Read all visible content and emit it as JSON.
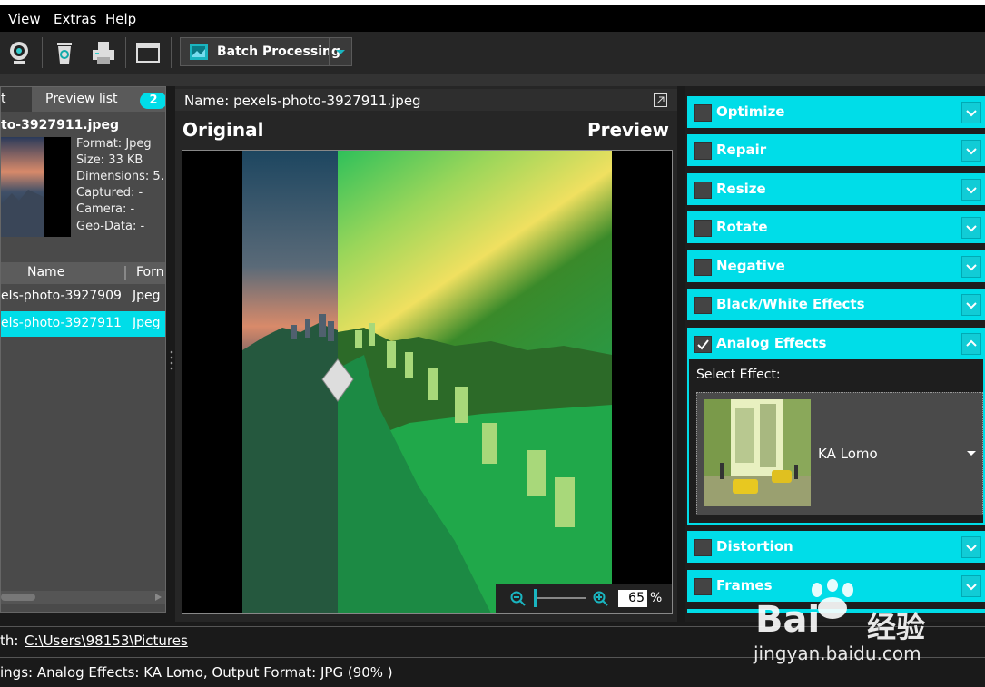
{
  "menu": {
    "view": "View",
    "extras": "Extras",
    "help": "Help"
  },
  "toolbar": {
    "batch_label": "Batch Processing"
  },
  "left_panel": {
    "tab_list": "t",
    "tab_preview": "Preview list",
    "badge_count": "2",
    "file_title": "to-3927911.jpeg",
    "info": {
      "format": "Format: Jpeg",
      "size": "Size: 33 KB",
      "dimensions": "Dimensions: 5...",
      "captured": "Captured: -",
      "camera": "Camera: -",
      "geo_label": "Geo-Data: ",
      "geo_value": "-"
    },
    "columns": {
      "name": "Name",
      "format": "Forn"
    },
    "rows": [
      {
        "name": "els-photo-3927909",
        "format": "Jpeg"
      },
      {
        "name": "els-photo-3927911",
        "format": "Jpeg"
      }
    ]
  },
  "center": {
    "name_label": "Name: pexels-photo-3927911.jpeg",
    "original": "Original",
    "preview": "Preview",
    "zoom_value": "65",
    "zoom_unit": "%"
  },
  "right_panel": {
    "sections": [
      "Optimize",
      "Repair",
      "Resize",
      "Rotate",
      "Negative",
      "Black/White Effects",
      "Analog Effects",
      "Distortion",
      "Frames"
    ],
    "select_effect_label": "Select Effect:",
    "effect_name": "KA Lomo"
  },
  "path_bar": {
    "label": "th:",
    "path": "C:\\Users\\98153\\Pictures"
  },
  "status_bar": {
    "text": "ings: Analog Effects: KA Lomo, Output Format: JPG (90% )"
  },
  "watermark": {
    "brand": "Bai",
    "brand_cn": "经验",
    "url": "jingyan.baidu.com"
  },
  "colors": {
    "accent": "#00dde8",
    "bg": "#1a1a1a",
    "panel": "#4a4a4a"
  }
}
